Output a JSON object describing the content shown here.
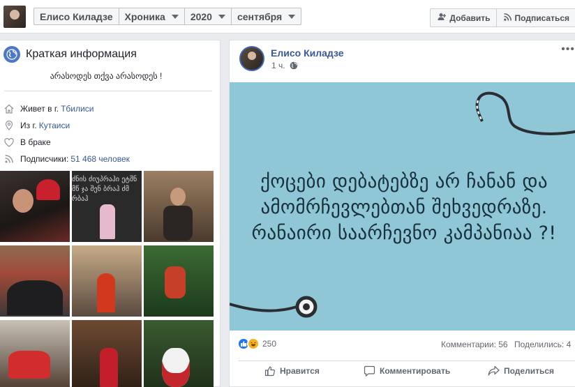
{
  "topbar": {
    "breadcrumbs": [
      {
        "label": "Елисо Киладзе",
        "dropdown": false
      },
      {
        "label": "Хроника",
        "dropdown": true
      },
      {
        "label": "2020",
        "dropdown": true
      },
      {
        "label": "сентября",
        "dropdown": true
      }
    ],
    "actions": {
      "add_label": "Добавить",
      "subscribe_label": "Подписаться"
    }
  },
  "intro": {
    "title": "Краткая информация",
    "bio": "არასოდეს თქვა არასოდეს !",
    "items": {
      "lives_prefix": "Живет в г.",
      "lives_city": "Тбилиси",
      "from_prefix": "Из г.",
      "from_city": "Кутаиси",
      "relationship": "В браке",
      "followers_prefix": "Подписчики:",
      "followers_link": "51 468 человек"
    }
  },
  "photos": {
    "count": 9
  },
  "post": {
    "author": "Елисо Киладзе",
    "time": "1 ч.",
    "privacy_icon": "globe-icon",
    "image_text": "ქოცები დებატებზე არ ჩანან და\nამომრჩევლებთან შეხვედრაზე.\nრანაირი საარჩევნო კამპანიაა ?!",
    "reactions": {
      "types": [
        "like",
        "haha"
      ],
      "count": "250"
    },
    "comments_label": "Комментарии: 56",
    "shares_label": "Поделились: 4",
    "actions": {
      "like_label": "Нравится",
      "comment_label": "Комментировать",
      "share_label": "Поделиться"
    }
  },
  "colors": {
    "link": "#385898",
    "accent": "#4267b2",
    "image_bg": "#8fc7d7",
    "page_bg": "#e9ebee"
  }
}
